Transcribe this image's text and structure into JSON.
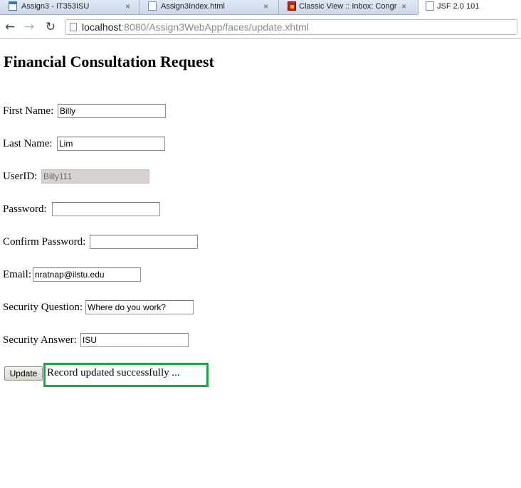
{
  "browser": {
    "tabs": [
      {
        "title": "Assign3 - IT353ISU",
        "icon": "app-icon"
      },
      {
        "title": "Assign3Index.html",
        "icon": "document-icon"
      },
      {
        "title": "Classic View :: Inbox: Congr",
        "icon": "mail-icon"
      },
      {
        "title": "JSF 2.0 101",
        "icon": "document-icon"
      }
    ],
    "close_glyph": "×",
    "back_glyph": "←",
    "forward_glyph": "→",
    "reload_glyph": "↻",
    "url_host": "localhost",
    "url_rest": ":8080/Assign3WebApp/faces/update.xhtml"
  },
  "page": {
    "title": "Financial Consultation Request",
    "fields": {
      "first_name": {
        "label": "First Name:",
        "value": "Billy"
      },
      "last_name": {
        "label": "Last Name:",
        "value": "Lim"
      },
      "user_id": {
        "label": "UserID:",
        "value": "Billy111"
      },
      "password": {
        "label": "Password:",
        "value": ""
      },
      "confirm_password": {
        "label": "Confirm Password:",
        "value": ""
      },
      "email": {
        "label": "Email:",
        "value": "nratnap@ilstu.edu"
      },
      "security_question": {
        "label": "Security Question:",
        "value": "Where do you work?"
      },
      "security_answer": {
        "label": "Security Answer:",
        "value": "ISU"
      }
    },
    "update_button": "Update",
    "status_message": "Record updated successfully ...",
    "status_border_color": "#22a548"
  }
}
